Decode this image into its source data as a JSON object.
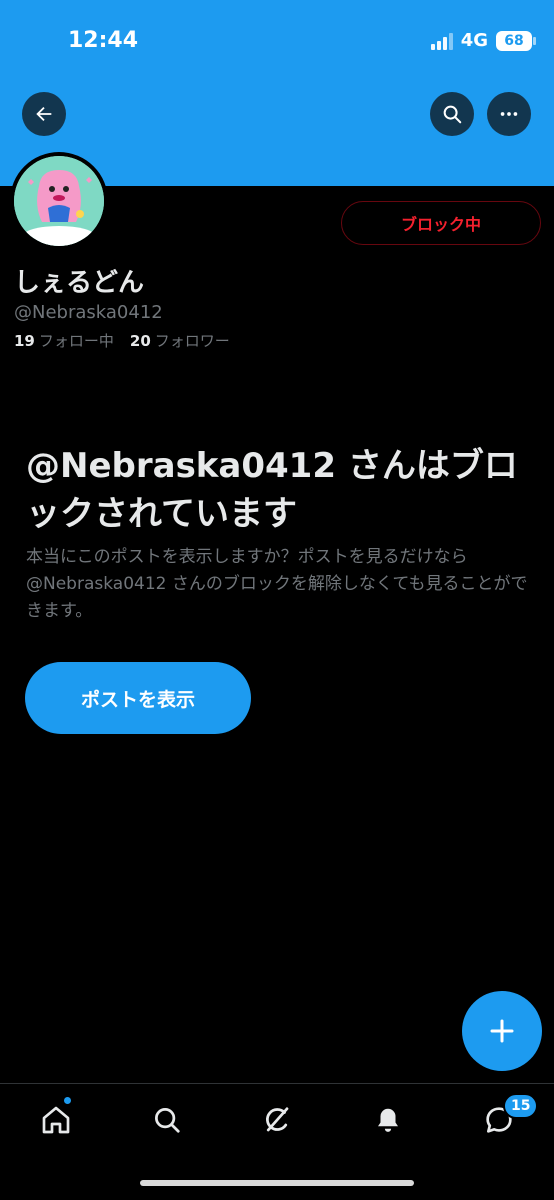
{
  "status_bar": {
    "time": "12:44",
    "network": "4G",
    "battery": "68"
  },
  "header": {
    "back_icon": "arrow-left-icon",
    "search_icon": "search-icon",
    "more_icon": "more-horizontal-icon",
    "banner_color": "#1d9bf0"
  },
  "profile": {
    "display_name": "しぇるどん",
    "handle": "@Nebraska0412",
    "following_count": "19",
    "following_label": "フォロー中",
    "followers_count": "20",
    "followers_label": "フォロワー",
    "blocked_button_label": "ブロック中"
  },
  "blocked_notice": {
    "headline": "@Nebraska0412 さんはブロックされています",
    "description": "本当にこのポストを表示しますか？ポストを見るだけなら @Nebraska0412 さんのブロックを解除しなくても見ることができます。",
    "view_posts_label": "ポストを表示"
  },
  "tabbar": {
    "items": [
      {
        "icon": "home-icon"
      },
      {
        "icon": "search-icon"
      },
      {
        "icon": "grok-icon"
      },
      {
        "icon": "bell-icon"
      },
      {
        "icon": "messages-icon"
      }
    ],
    "messages_badge": "15"
  },
  "colors": {
    "accent": "#1d9bf0",
    "block_red": "#f4212e",
    "muted": "#71767b"
  }
}
